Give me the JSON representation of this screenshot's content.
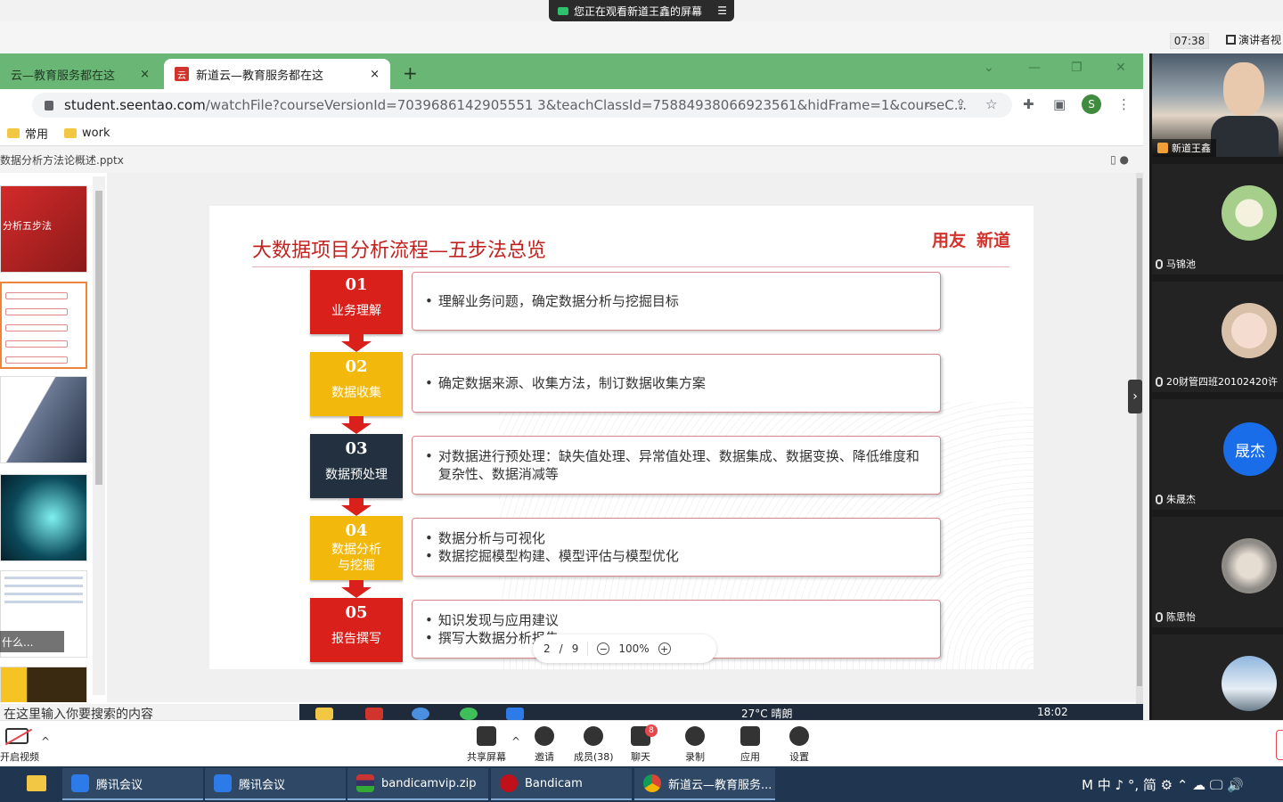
{
  "share_banner": {
    "text": "您正在观看新道王鑫的屏幕",
    "menu": "☰"
  },
  "meeting": {
    "time": "07:38",
    "presenter_view": "演讲者视"
  },
  "browser": {
    "tabs": [
      {
        "label": "云—教育服务都在这",
        "close": "×"
      },
      {
        "label": "新道云—教育服务都在这",
        "close": "×",
        "favicon": "云"
      }
    ],
    "new_tab": "+",
    "window_controls": {
      "down": "⌄",
      "minimize": "—",
      "restore": "❐",
      "close": "✕"
    },
    "url_host": "student.seentao.com",
    "url_path": "/watchFile?courseVersionId=7039686142905551 3&teachClassId=75884938066923561&hidFrame=1&courseC...",
    "profile_initial": "S",
    "bookmarks": [
      "常用",
      "work"
    ]
  },
  "viewer": {
    "filename": "数据分析方法论概述.pptx",
    "thumb1_title": "分析五步法",
    "search_hint": "什么...",
    "page_current": "2",
    "page_sep": "/",
    "page_total": "9",
    "zoom": "100%",
    "zoom_out": "−",
    "zoom_in": "+"
  },
  "slide": {
    "title": "大数据项目分析流程—五步法总览",
    "logo_left": "用友",
    "logo_right": "新道",
    "steps": [
      {
        "num": "01",
        "label": "业务理解",
        "color": "#d9201b",
        "bullets": [
          "理解业务问题，确定数据分析与挖掘目标"
        ]
      },
      {
        "num": "02",
        "label": "数据收集",
        "color": "#f2b80c",
        "bullets": [
          "确定数据来源、收集方法，制订数据收集方案"
        ]
      },
      {
        "num": "03",
        "label": "数据预处理",
        "color": "#22303f",
        "bullets": [
          "对数据进行预处理：缺失值处理、异常值处理、数据集成、数据变换、降低维度和复杂性、数据消减等"
        ]
      },
      {
        "num": "04",
        "label": "数据分析与挖掘",
        "color": "#f2b80c",
        "bullets": [
          "数据分析与可视化",
          "数据挖掘模型构建、模型评估与模型优化"
        ]
      },
      {
        "num": "05",
        "label": "报告撰写",
        "color": "#d9201b",
        "bullets": [
          "知识发现与应用建议",
          "撰写大数据分析报告"
        ]
      }
    ]
  },
  "inner_screen": {
    "search_placeholder": "在这里输入你要搜索的内容",
    "weather": "27°C 晴朗",
    "time": "18:02"
  },
  "participants": [
    {
      "name": "新道王鑫"
    },
    {
      "name": "马锦池"
    },
    {
      "name": "20财管四班20102420许"
    },
    {
      "name": "朱晟杰",
      "avatar_text": "晟杰"
    },
    {
      "name": "陈思怡"
    },
    {
      "name": ""
    }
  ],
  "toolbar": {
    "camera": "开启视频",
    "share": "共享屏幕",
    "invite": "邀请",
    "members": "成员(38)",
    "chat": "聊天",
    "chat_badge": "8",
    "record": "录制",
    "apps": "应用",
    "settings": "设置"
  },
  "taskbar": {
    "items": [
      "腾讯会议",
      "腾讯会议",
      "bandicamvip.zip",
      "Bandicam",
      "新道云—教育服务..."
    ],
    "tray": "M 中 ♪ °, 简 ⚙ ⌃ ☁ 🖵 🔊"
  }
}
